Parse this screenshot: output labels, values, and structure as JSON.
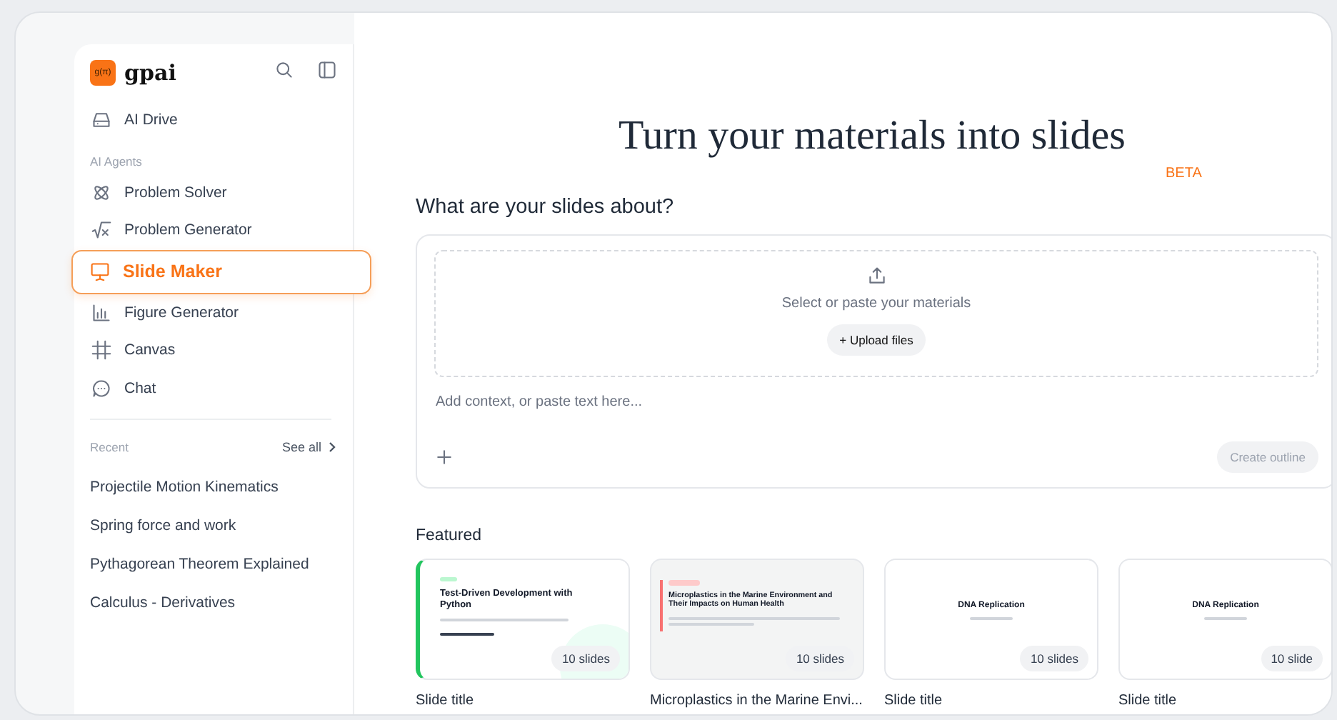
{
  "brand": {
    "logo_text": "g(π)",
    "name": "gpai"
  },
  "sidebar": {
    "top_items": [
      {
        "label": "AI Drive",
        "selected": false
      }
    ],
    "section_label": "AI Agents",
    "agents": [
      {
        "label": "Problem Solver",
        "selected": false
      },
      {
        "label": "Problem Generator",
        "selected": false
      },
      {
        "label": "Slide Maker",
        "selected": true
      },
      {
        "label": "Figure Generator",
        "selected": false
      },
      {
        "label": "Canvas",
        "selected": false
      },
      {
        "label": "Chat",
        "selected": false
      }
    ],
    "recent": {
      "label": "Recent",
      "see_all": "See all",
      "items": [
        "Projectile Motion Kinematics",
        "Spring force and work",
        "Pythagorean Theorem Explained",
        "Calculus - Derivatives"
      ]
    }
  },
  "main": {
    "title": "Turn your materials into slides",
    "badge": "BETA",
    "question": "What are your slides about?",
    "dropzone": {
      "hint": "Select or paste your materials",
      "button": "+ Upload files"
    },
    "context": {
      "placeholder": "Add context, or paste text here..."
    },
    "create_button": {
      "label": "Create outline",
      "disabled": true
    },
    "featured": {
      "label": "Featured",
      "cards": [
        {
          "kind": "accent-green",
          "heading": "Test-Driven Development with Python",
          "count": "10 slides",
          "title": "Slide title"
        },
        {
          "kind": "accent-red",
          "heading": "Microplastics in the Marine Environment and Their Impacts on Human Health",
          "count": "10 slides",
          "title": "Microplastics in the Marine Envi..."
        },
        {
          "kind": "centered",
          "heading": "DNA Replication",
          "count": "10 slides",
          "title": "Slide title"
        },
        {
          "kind": "centered",
          "heading": "DNA Replication",
          "count": "10 slide",
          "title": "Slide title"
        }
      ]
    }
  }
}
